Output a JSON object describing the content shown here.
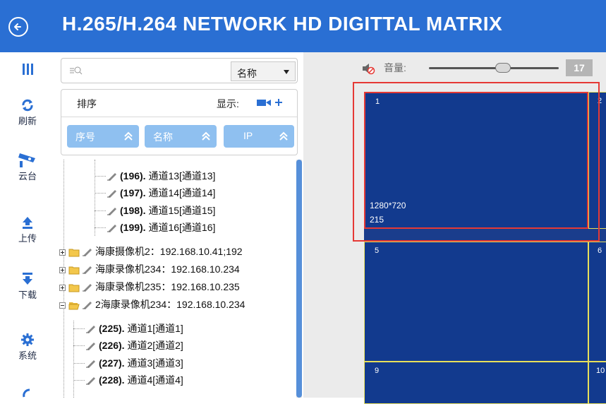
{
  "app": {
    "title": "H.265/H.264 NETWORK HD DIGITTAL MATRIX"
  },
  "colors": {
    "header": "#2a6fd3",
    "grid_bg": "#123a8e",
    "grid_line": "#e8e05a",
    "selection": "#e53935",
    "sort_btn": "#8fc0f0"
  },
  "sidebar": {
    "items": [
      {
        "icon": "menu-icon",
        "label": ""
      },
      {
        "icon": "refresh-icon",
        "label": "刷新"
      },
      {
        "icon": "camera-icon",
        "label": "云台"
      },
      {
        "icon": "upload-icon",
        "label": "上传"
      },
      {
        "icon": "download-icon",
        "label": "下载"
      },
      {
        "icon": "gear-icon",
        "label": "系统"
      },
      {
        "icon": "partial-icon",
        "label": ""
      }
    ]
  },
  "search": {
    "placeholder": "",
    "select_value": "名称"
  },
  "sort": {
    "label": "排序",
    "display_label": "显示:",
    "buttons": [
      {
        "label": "序号"
      },
      {
        "label": "名称"
      },
      {
        "label": "IP"
      }
    ]
  },
  "tree": {
    "channels_top": [
      {
        "num": "(196).",
        "name": "通道13[通道13]"
      },
      {
        "num": "(197).",
        "name": "通道14[通道14]"
      },
      {
        "num": "(198).",
        "name": "通道15[通道15]"
      },
      {
        "num": "(199).",
        "name": "通道16[通道16]"
      }
    ],
    "devices": [
      {
        "name": "海康摄像机2：192.168.10.41;192"
      },
      {
        "name": "海康录像机234：192.168.10.234"
      },
      {
        "name": "海康录像机235：192.168.10.235"
      },
      {
        "name": "2海康录像机234：192.168.10.234"
      }
    ],
    "channels_bottom": [
      {
        "num": "(225).",
        "name": "通道1[通道1]"
      },
      {
        "num": "(226).",
        "name": "通道2[通道2]"
      },
      {
        "num": "(227).",
        "name": "通道3[通道3]"
      },
      {
        "num": "(228).",
        "name": "通道4[通道4]"
      }
    ]
  },
  "volume": {
    "label": "音量:",
    "value": "17"
  },
  "matrix": {
    "cells": [
      {
        "num": "1",
        "resolution": "1280*720",
        "bitrate": "215"
      },
      {
        "num": "2"
      },
      {
        "num": "5"
      },
      {
        "num": "6"
      },
      {
        "num": "9"
      },
      {
        "num": "10"
      }
    ]
  }
}
